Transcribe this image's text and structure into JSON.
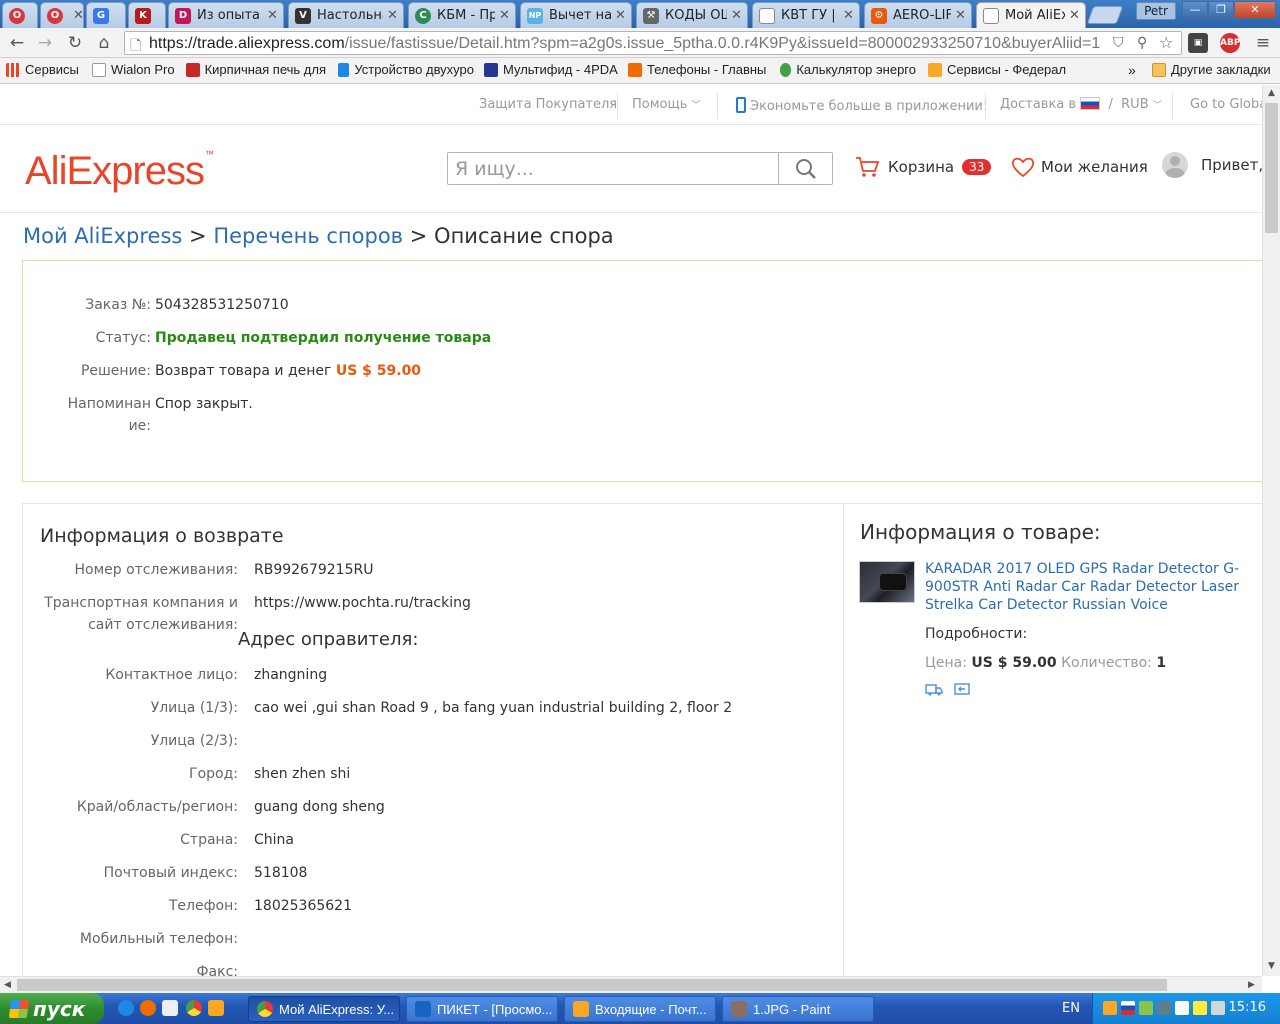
{
  "browser": {
    "tabs": [
      {
        "label": "",
        "icon": "opera-icon",
        "color": "#d9373b"
      },
      {
        "label": "",
        "icon": "opera-icon",
        "color": "#d9373b"
      },
      {
        "label": "",
        "icon": "g-icon",
        "color": "#3b78e7"
      },
      {
        "label": "",
        "icon": "k-icon",
        "color": "#b71c1c"
      },
      {
        "label": "Из опыта",
        "icon": "d-icon",
        "color": "#c2185b"
      },
      {
        "label": "Настольна",
        "icon": "v-icon",
        "color": "#333333"
      },
      {
        "label": "КБМ - Про",
        "icon": "c-icon",
        "color": "#2e8b57"
      },
      {
        "label": "Вычет на",
        "icon": "np-icon",
        "color": "#5ab3e6"
      },
      {
        "label": "КОДЫ ОШ",
        "icon": "tool-icon",
        "color": "#666666"
      },
      {
        "label": "КВТ ГУ | ",
        "icon": "page-icon",
        "color": "#888888"
      },
      {
        "label": "AERO-LIFT",
        "icon": "gear-icon",
        "color": "#e8590c"
      },
      {
        "label": "Мой AliEx",
        "icon": "page-icon",
        "color": "#888888"
      }
    ],
    "user": "Petr",
    "url_main": "https://trade.aliexpress.com",
    "url_rest": "/issue/fastissue/Detail.htm?spm=a2g0s.issue_5ptha.0.0.r4K9Py&issueId=800002933250710&buyerAliid=1"
  },
  "bookmarks": [
    {
      "label": "Сервисы",
      "icon": "apps-icon",
      "color": "#e8462a"
    },
    {
      "label": "Wialon Pro",
      "icon": "page-icon",
      "color": "#cccccc"
    },
    {
      "label": "Кирпичная печь для",
      "icon": "stove-icon",
      "color": "#c62828"
    },
    {
      "label": "Устройство двухуро",
      "icon": "house-icon",
      "color": "#1e88e5"
    },
    {
      "label": "Мультифид - 4PDA",
      "icon": "4pda-icon",
      "color": "#283593"
    },
    {
      "label": "Телефоны - Главны",
      "icon": "phone-icon",
      "color": "#ef6c00"
    },
    {
      "label": "Калькулятор энерго",
      "icon": "c-icon",
      "color": "#43a047"
    },
    {
      "label": "Сервисы - Федерал",
      "icon": "emblem-icon",
      "color": "#f9a825"
    }
  ],
  "bookmarks_more": "»",
  "bookmarks_other": "Другие закладки",
  "topnav": {
    "protection": "Защита Покупателя",
    "help": "Помощь",
    "app": "Экономьте больше в приложении!",
    "delivery": "Доставка в",
    "currency": "RUB",
    "global": "Go to Global"
  },
  "header": {
    "logo": "AliExpress",
    "logo_tm": "™",
    "search_placeholder": "Я ищу...",
    "cart_label": "Корзина",
    "cart_count": "33",
    "wishlist_label": "Мои желания",
    "greeting": "Привет,"
  },
  "breadcrumb": {
    "item1": "Мой AliExpress",
    "sep": ">",
    "item2": "Перечень споров",
    "current": "Описание спора"
  },
  "summary": {
    "order_label": "Заказ №:",
    "order_value": "504328531250710",
    "status_label": "Статус:",
    "status_value": "Продавец подтвердил получение товара",
    "decision_label": "Решение:",
    "decision_value": "Возврат товара и денег",
    "decision_amount": "US $ 59.00",
    "reminder_label": "Напоминание:",
    "reminder_value": "Спор закрыт."
  },
  "return_info": {
    "title": "Информация о возврате",
    "tracking_label": "Номер отслеживания:",
    "tracking_value": "RB992679215RU",
    "carrier_label": "Транспортная компания и сайт отслеживания:",
    "carrier_value": "https://www.pochta.ru/tracking",
    "address_title": "Адрес оправителя:",
    "contact_label": "Контактное лицо:",
    "contact_value": "zhangning",
    "street1_label": "Улица (1/3):",
    "street1_value": "cao wei ,gui shan Road 9 , ba fang yuan industrial building 2, floor 2",
    "street2_label": "Улица (2/3):",
    "street2_value": "",
    "city_label": "Город:",
    "city_value": "shen zhen shi",
    "region_label": "Край/область/регион:",
    "region_value": "guang dong sheng",
    "country_label": "Страна:",
    "country_value": "China",
    "zip_label": "Почтовый индекс:",
    "zip_value": "518108",
    "phone_label": "Телефон:",
    "phone_value": "18025365621",
    "mobile_label": "Мобильный телефон:",
    "mobile_value": "",
    "fax_label": "Факс:"
  },
  "product_info": {
    "title": "Информация о товаре:",
    "name": "KARADAR 2017 OLED GPS Radar Detector G-900STR Anti Radar Car Radar Detector Laser Strelka Car Detector Russian Voice",
    "details_label": "Подробности:",
    "price_label": "Цена:",
    "price_value": "US $ 59.00",
    "qty_label": "Количество:",
    "qty_value": "1"
  },
  "taskbar": {
    "start": "пуск",
    "items": [
      {
        "label": "Мой AliExpress: У...",
        "icon": "chrome-icon",
        "color": "#4caf50"
      },
      {
        "label": "ПИКЕТ - [Просмо...",
        "icon": "piket-icon",
        "color": "#1565c0"
      },
      {
        "label": "Входящие - Почт...",
        "icon": "outlook-icon",
        "color": "#f9a825"
      },
      {
        "label": "1.JPG - Paint",
        "icon": "paint-icon",
        "color": "#8d6e63"
      }
    ],
    "lang": "EN",
    "clock": "15:16"
  },
  "colors": {
    "link": "#2b6db3",
    "status_green": "#2a8a14",
    "price_orange": "#e8590c",
    "brand": "#e8462a",
    "badge_red": "#e32f2f"
  }
}
